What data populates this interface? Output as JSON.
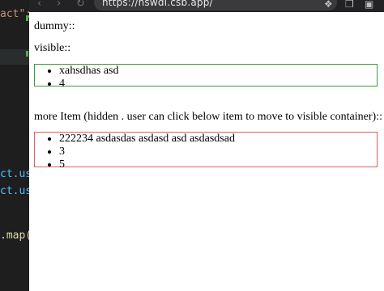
{
  "browser": {
    "url": "https://hswdl.csb.app/"
  },
  "editor": {
    "lines": [
      {
        "parts": [
          {
            "t": "act\";",
            "c": "str"
          }
        ]
      },
      {
        "parts": [
          {
            "t": "ct.us",
            "c": "id"
          }
        ]
      },
      {
        "parts": [
          {
            "t": "ct.us",
            "c": "id"
          }
        ]
      },
      {
        "parts": [
          {
            "t": ".map(",
            "c": "fn"
          }
        ]
      }
    ]
  },
  "page": {
    "dummy_label": "dummy::",
    "visible_label": "visible::",
    "visible_items": [
      "xahsdhas asd",
      "4"
    ],
    "more_label": "more Item (hidden . user can click below item to move to visible container)::",
    "hidden_items": [
      "222234 asdasdas asdasd asd asdasdsad",
      "3",
      "5"
    ]
  }
}
